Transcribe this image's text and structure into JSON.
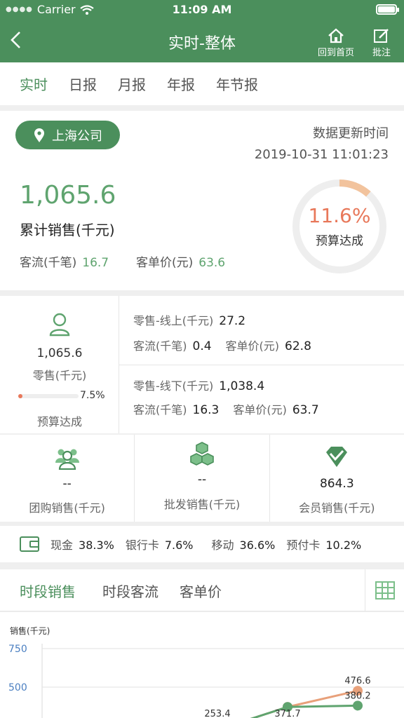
{
  "status_bar": {
    "carrier": "Carrier",
    "time": "11:09 AM"
  },
  "nav": {
    "title": "实时-整体",
    "home_label": "回到首页",
    "note_label": "批注"
  },
  "tabs": [
    {
      "label": "实时",
      "active": true
    },
    {
      "label": "日报",
      "active": false
    },
    {
      "label": "月报",
      "active": false
    },
    {
      "label": "年报",
      "active": false
    },
    {
      "label": "年节报",
      "active": false
    }
  ],
  "summary": {
    "company": "上海公司",
    "update_label": "数据更新时间",
    "update_time": "2019-10-31 11:01:23",
    "sales_value": "1,065.6",
    "sales_label": "累计销售(千元)",
    "traffic_label": "客流(千笔)",
    "traffic_value": "16.7",
    "unit_price_label": "客单价(元)",
    "unit_price_value": "63.6",
    "budget_pct": "11.6%",
    "budget_fraction": 0.116,
    "budget_label": "预算达成"
  },
  "retail": {
    "value": "1,065.6",
    "label": "零售(千元)",
    "budget_pct_text": "7.5%",
    "budget_fraction": 0.075,
    "budget_label": "预算达成",
    "online": {
      "label": "零售-线上(千元)",
      "value": "27.2",
      "traffic_label": "客流(千笔)",
      "traffic_value": "0.4",
      "price_label": "客单价(元)",
      "price_value": "62.8"
    },
    "offline": {
      "label": "零售-线下(千元)",
      "value": "1,038.4",
      "traffic_label": "客流(千笔)",
      "traffic_value": "16.3",
      "price_label": "客单价(元)",
      "price_value": "63.7"
    }
  },
  "channels": [
    {
      "icon": "group-icon",
      "value": "--",
      "label": "团购销售(千元)"
    },
    {
      "icon": "boxes-icon",
      "value": "--",
      "label": "批发销售(千元)"
    },
    {
      "icon": "diamond-icon",
      "value": "864.3",
      "label": "会员销售(千元)"
    }
  ],
  "payment": [
    {
      "label": "现金",
      "value": "38.3%"
    },
    {
      "label": "银行卡",
      "value": "7.6%"
    },
    {
      "label": "移动",
      "value": "36.6%"
    },
    {
      "label": "预付卡",
      "value": "10.2%"
    }
  ],
  "chart_tabs": [
    {
      "label": "时段销售",
      "active": true
    },
    {
      "label": "时段客流",
      "active": false
    },
    {
      "label": "客单价",
      "active": false
    }
  ],
  "colors": {
    "brand": "#4b8f5c",
    "accent": "#e8785a",
    "value_green": "#5fa46f"
  },
  "chart_data": {
    "type": "line",
    "ylabel": "销售(千元)",
    "yticks": [
      "750",
      "500"
    ],
    "ylim": [
      250,
      750
    ],
    "x": [
      1,
      2,
      3,
      4
    ],
    "series": [
      {
        "name": "",
        "color": "#e8a07a",
        "values": [
          null,
          253.4,
          371.7,
          476.6
        ]
      },
      {
        "name": "",
        "color": "#5fa46f",
        "values": [
          null,
          253.4,
          371.7,
          380.2
        ]
      }
    ],
    "labels": [
      {
        "text": "253.4"
      },
      {
        "text": "371.7"
      },
      {
        "text": "476.6"
      },
      {
        "text": "380.2"
      }
    ]
  }
}
